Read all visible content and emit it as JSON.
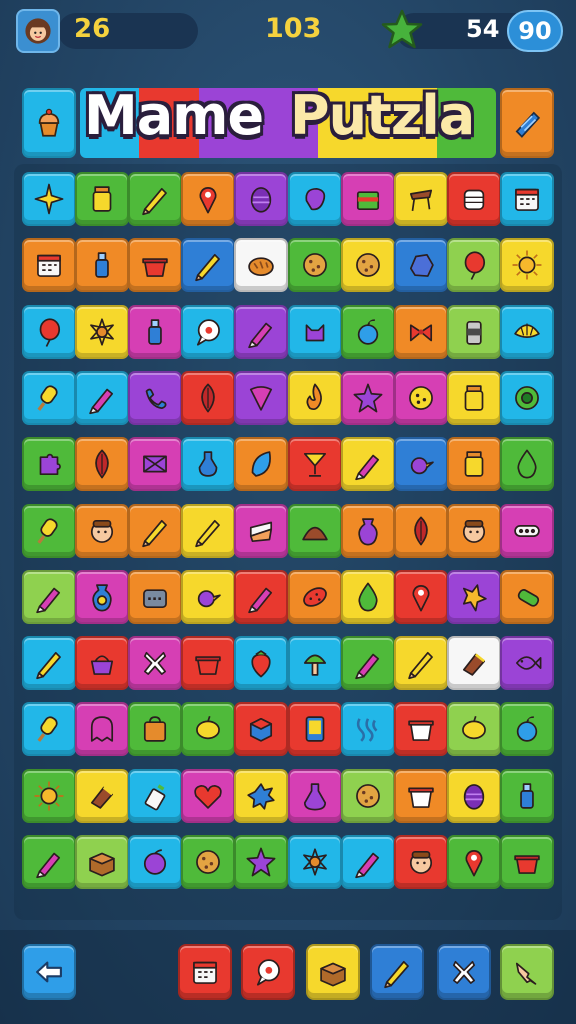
{
  "hud": {
    "avatar_icon": "girl-avatar-icon",
    "level": "26",
    "score": "103",
    "star_icon": "green-star-icon",
    "moves": "54",
    "badge": "90"
  },
  "title": {
    "word1": "Mame",
    "word2": "Putzla",
    "left_tile_icon": "cupcake-icon",
    "right_tile_icon": "shell-icon"
  },
  "colors": {
    "cyan": "#22b7e8",
    "green": "#4fba3a",
    "orange": "#f08a26",
    "yellow": "#f6d82c",
    "red": "#e8392f",
    "purple": "#9b44d6",
    "magenta": "#d63fb4",
    "lime": "#8fd14f",
    "blue": "#2f7fd6",
    "white": "#f7f7f7",
    "background": "#25496a"
  },
  "grid": {
    "rows": [
      [
        "cyan:sparkle-icon",
        "green:jar-icon",
        "green:pencil-icon",
        "orange:pin-icon",
        "purple:egg-icon",
        "cyan:blob-icon",
        "magenta:cake-icon",
        "yellow:stool-icon",
        "red:drum-icon",
        "cyan:calendar-icon"
      ],
      [
        "orange:calendar-icon",
        "orange:bottle-icon",
        "orange:pot-icon",
        "blue:pencil-icon",
        "white:bread-icon",
        "green:cookie-icon",
        "yellow:cookie-icon",
        "blue:rock-icon",
        "lime:balloon-icon",
        "yellow:sun-icon"
      ],
      [
        "cyan:balloon-icon",
        "yellow:flower-icon",
        "magenta:bottle-icon",
        "cyan:chat-icon",
        "purple:crayon-icon",
        "cyan:cat-icon",
        "green:apple-icon",
        "orange:bow-icon",
        "lime:can-icon",
        "cyan:shell-icon"
      ],
      [
        "cyan:popsicle-icon",
        "cyan:crayon-icon",
        "purple:phone-icon",
        "red:leaf-icon",
        "purple:fan-icon",
        "yellow:flame-icon",
        "magenta:star-icon",
        "magenta:melon-icon",
        "yellow:jar-icon",
        "cyan:ring-icon"
      ],
      [
        "green:puzzle-icon",
        "orange:leaf-icon",
        "magenta:envelope-icon",
        "cyan:potion-icon",
        "orange:feather-icon",
        "red:glass-icon",
        "yellow:crayon-icon",
        "blue:bird-icon",
        "orange:jar-icon",
        "green:drop-icon"
      ],
      [
        "green:popsicle-icon",
        "orange:face-icon",
        "orange:pencil-icon",
        "yellow:pencil-icon",
        "magenta:sandwich-icon",
        "green:pile-icon",
        "orange:vase-icon",
        "orange:leaf-icon",
        "orange:face-icon",
        "magenta:dots-icon"
      ],
      [
        "lime:crayon-icon",
        "magenta:eye-icon",
        "orange:radio-icon",
        "yellow:bird-icon",
        "red:crayon-icon",
        "orange:bean-icon",
        "yellow:drop-icon",
        "red:pin-icon",
        "purple:bolt-icon",
        "orange:tube-icon"
      ],
      [
        "cyan:pencil-icon",
        "red:basket-icon",
        "magenta:cross-icon",
        "red:pot-icon",
        "cyan:strawberry-icon",
        "cyan:mushroom-icon",
        "green:crayon-icon",
        "yellow:pencil-icon",
        "white:brush-icon",
        "purple:fish-icon"
      ],
      [
        "cyan:popsicle-icon",
        "magenta:ghost-icon",
        "green:bag-icon",
        "green:lemon-icon",
        "red:cube-icon",
        "red:tablet-icon",
        "cyan:wave-icon",
        "red:bucket-icon",
        "lime:lemon-icon",
        "green:apple-icon"
      ],
      [
        "green:sun-icon",
        "yellow:brush-icon",
        "cyan:glue-icon",
        "magenta:heart-icon",
        "yellow:splat-icon",
        "magenta:flask-icon",
        "lime:cookie-icon",
        "orange:bucket-icon",
        "yellow:egg-icon",
        "green:bottle-icon"
      ],
      [
        "green:crayon-icon",
        "lime:box-icon",
        "cyan:plum-icon",
        "green:cookie-icon",
        "green:star-icon",
        "cyan:flower-icon",
        "cyan:crayon-icon",
        "red:face-icon",
        "green:pin-icon",
        "green:pot-icon"
      ]
    ]
  },
  "toolbar": {
    "back_icon": "back-arrow-icon",
    "items": [
      {
        "color": "red",
        "icon": "calendar-icon"
      },
      {
        "color": "red",
        "icon": "chat-icon"
      },
      {
        "color": "yellow",
        "icon": "box-icon"
      },
      {
        "color": "blue",
        "icon": "pencil-icon"
      },
      {
        "color": "blue",
        "icon": "cross-icon"
      },
      {
        "color": "lime",
        "icon": "hand-icon"
      }
    ]
  }
}
